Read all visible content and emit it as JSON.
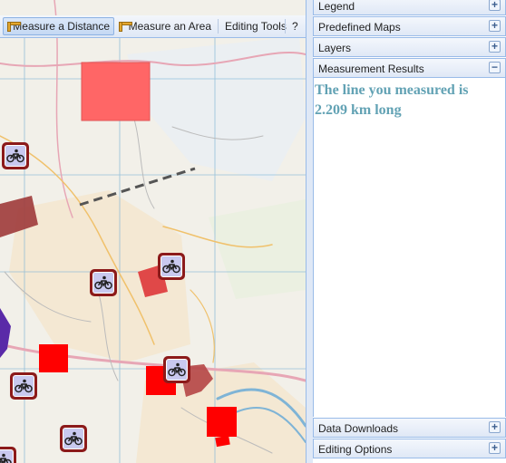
{
  "toolbar": {
    "measure_distance": "Measure a Distance",
    "measure_area": "Measure an Area",
    "editing_tools": "Editing Tools",
    "help": "?"
  },
  "panels": {
    "legend": "Legend",
    "predefined_maps": "Predefined Maps",
    "layers": "Layers",
    "measurement_results": "Measurement Results",
    "data_downloads": "Data Downloads",
    "editing_options": "Editing Options",
    "expand_symbol": "+",
    "collapse_symbol": "−"
  },
  "measurement": {
    "result_text": "The line you measured is 2.209 km long"
  },
  "icons": {
    "poi": "cycling-icon",
    "ruler": "ruler-icon",
    "area": "measure-area-icon"
  },
  "colors": {
    "accent": "#99bbe8",
    "result_text": "#62a2b4",
    "poi_border": "#8c1a1a",
    "red_overlay": "#ff0000"
  }
}
